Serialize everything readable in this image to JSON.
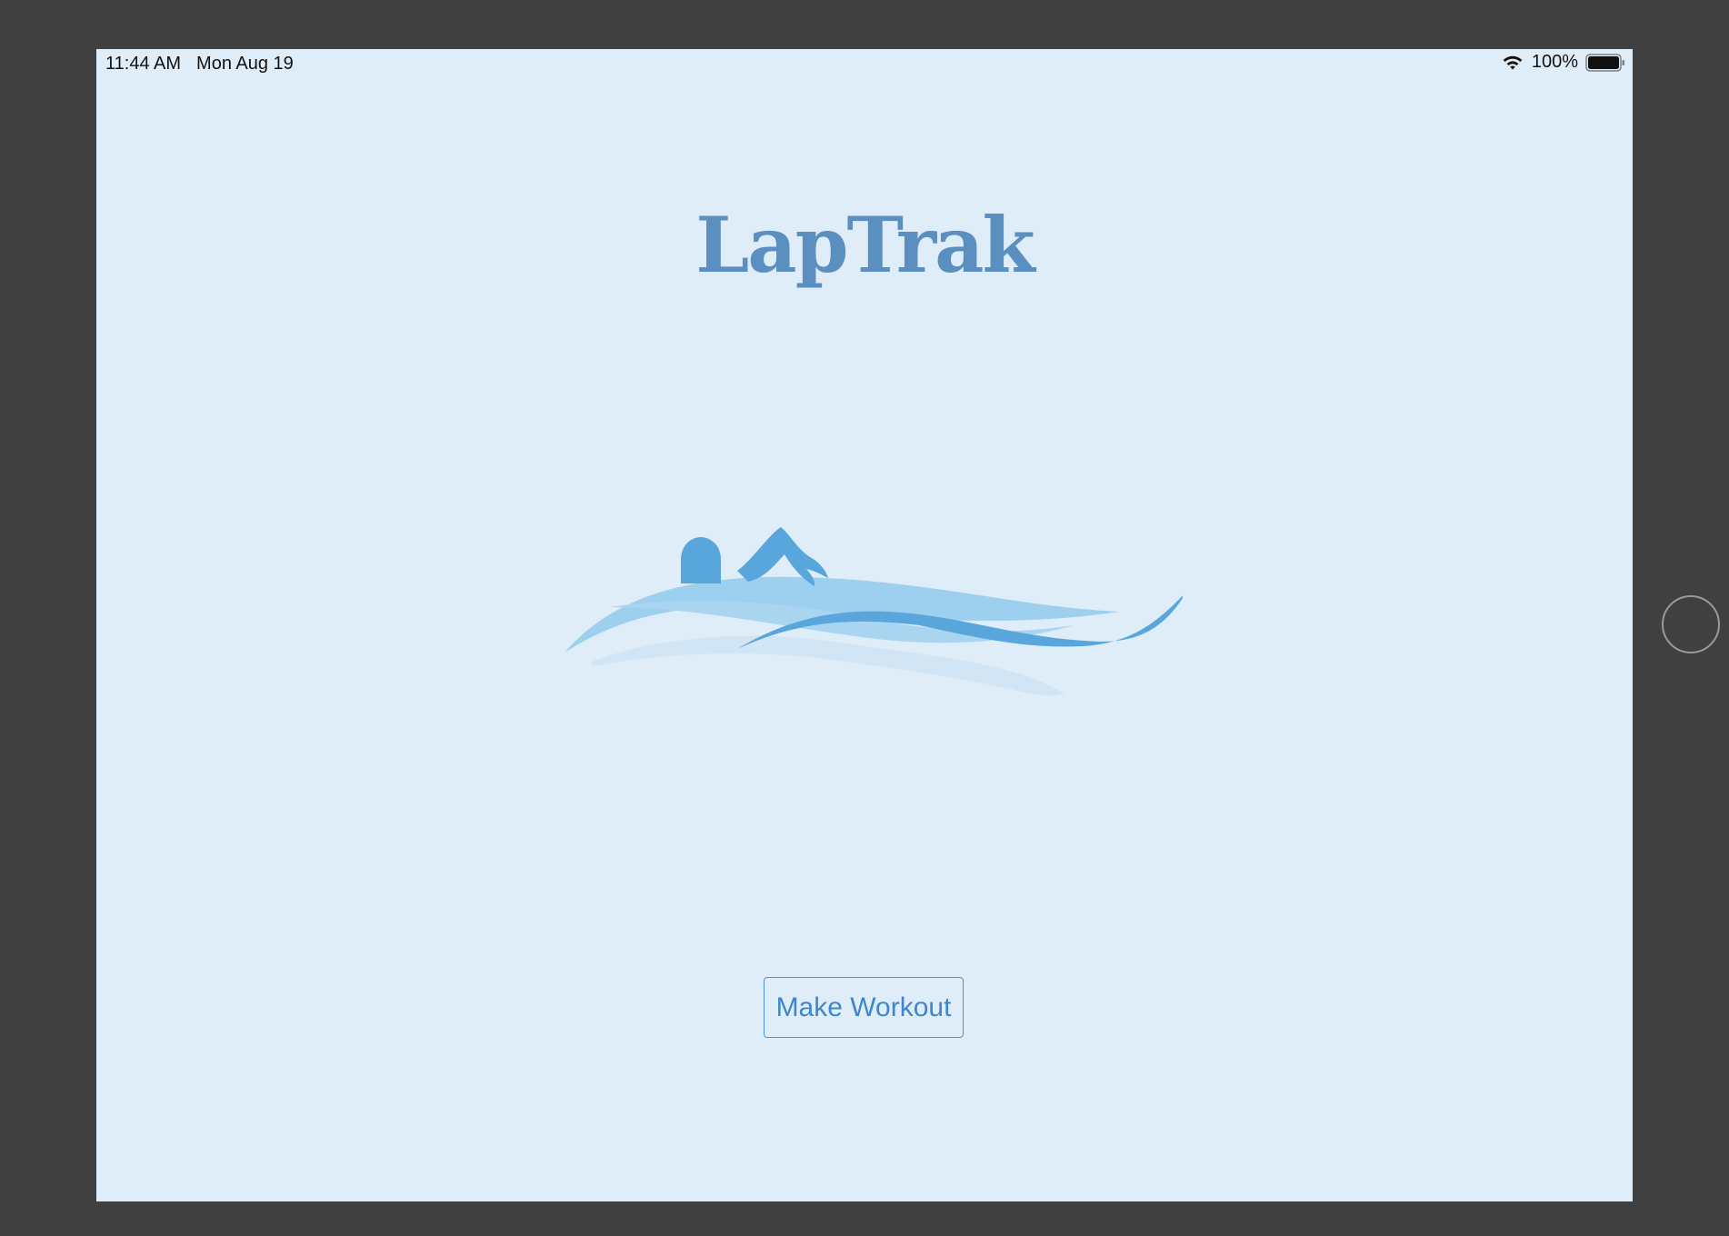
{
  "status_bar": {
    "time": "11:44 AM",
    "date": "Mon Aug 19",
    "battery_text": "100%",
    "battery_level": 1.0,
    "icons": [
      "wifi-icon",
      "battery-icon"
    ]
  },
  "app": {
    "title": "LapTrak",
    "logo_icon": "swimmer-waves-logo",
    "make_workout_label": "Make Workout"
  },
  "colors": {
    "screen_background": "#dfedf9",
    "title": "#5a8fbf",
    "button_accent": "#3f87c9",
    "wave_dark": "#59a6dc",
    "wave_light": "#9dcfee",
    "frame": "#404040"
  }
}
